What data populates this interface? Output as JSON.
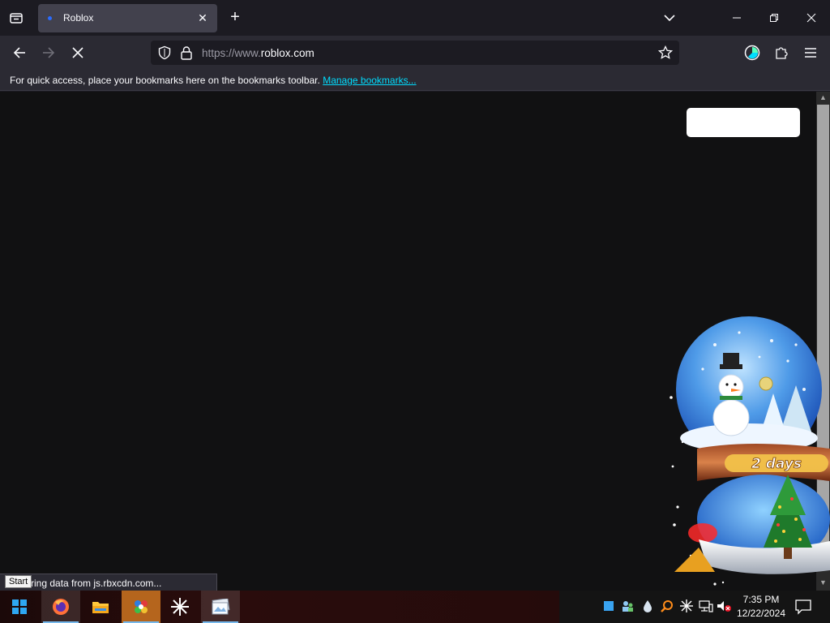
{
  "browser": {
    "tab": {
      "title": "Roblox"
    },
    "url": {
      "prefix": "https://www.",
      "domain": "roblox.com"
    },
    "bookmarks_bar": {
      "message": "For quick access, place your bookmarks here on the bookmarks toolbar.",
      "link": "Manage bookmarks..."
    },
    "status_text": "rring data from js.rbxcdn.com...",
    "tooltip": "Start"
  },
  "widget": {
    "banner": "2 days"
  },
  "taskbar": {
    "apps": [
      "windows-start",
      "firefox",
      "file-explorer",
      "app-orange",
      "asterisk-app",
      "photo-viewer"
    ],
    "clock": {
      "time": "7:35 PM",
      "date": "12/22/2024"
    }
  },
  "colors": {
    "tabbar_bg": "#1c1b22",
    "toolbar_bg": "#2b2a33",
    "page_bg": "#111112",
    "link": "#00ddff"
  }
}
